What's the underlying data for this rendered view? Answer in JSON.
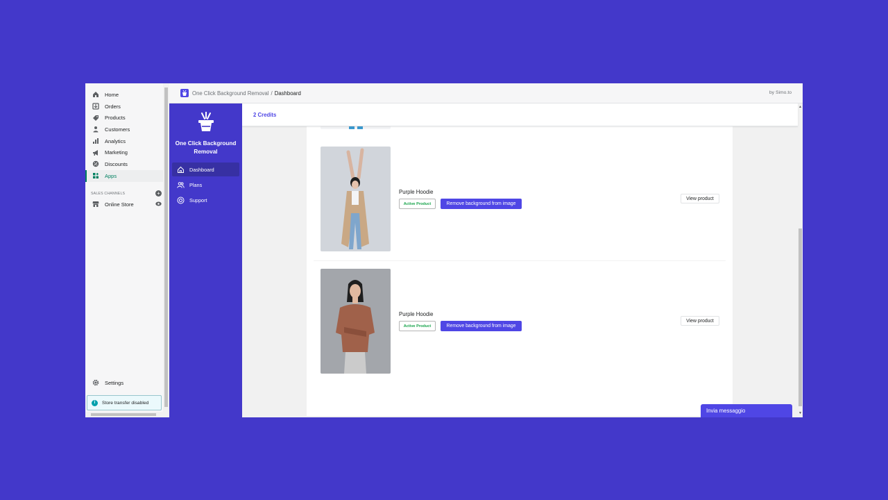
{
  "admin_nav": {
    "items": [
      {
        "label": "Home",
        "icon": "home-icon"
      },
      {
        "label": "Orders",
        "icon": "orders-icon"
      },
      {
        "label": "Products",
        "icon": "tag-icon"
      },
      {
        "label": "Customers",
        "icon": "person-icon"
      },
      {
        "label": "Analytics",
        "icon": "bar-chart-icon"
      },
      {
        "label": "Marketing",
        "icon": "megaphone-icon"
      },
      {
        "label": "Discounts",
        "icon": "discount-icon"
      },
      {
        "label": "Apps",
        "icon": "apps-icon",
        "active": true
      }
    ],
    "sales_channels_title": "SALES CHANNELS",
    "online_store_label": "Online Store",
    "settings_label": "Settings",
    "store_transfer_text": "Store transfer disabled"
  },
  "header": {
    "app_name": "One Click Background Removal",
    "separator": "/",
    "page": "Dashboard",
    "byline": "by Simo.to"
  },
  "app_sidebar": {
    "brand_name": "One Click Background Removal",
    "items": [
      {
        "label": "Dashboard",
        "icon": "home-icon",
        "active": true
      },
      {
        "label": "Plans",
        "icon": "users-icon"
      },
      {
        "label": "Support",
        "icon": "support-icon"
      }
    ]
  },
  "credits": "2 Credits",
  "products": [
    {
      "title": "Purple Hoodie",
      "status": "Active Product",
      "remove_label": "Remove background from image",
      "view_label": "View product"
    },
    {
      "title": "Purple Hoodie",
      "status": "Active Product",
      "remove_label": "Remove background from image",
      "view_label": "View product"
    }
  ],
  "chat_label": "Invia messaggio",
  "colors": {
    "background": "#4338ca",
    "app_sidebar": "#4338ca",
    "primary": "#4f46e5",
    "shopify_green": "#008060",
    "active_badge": "#16a34a"
  }
}
